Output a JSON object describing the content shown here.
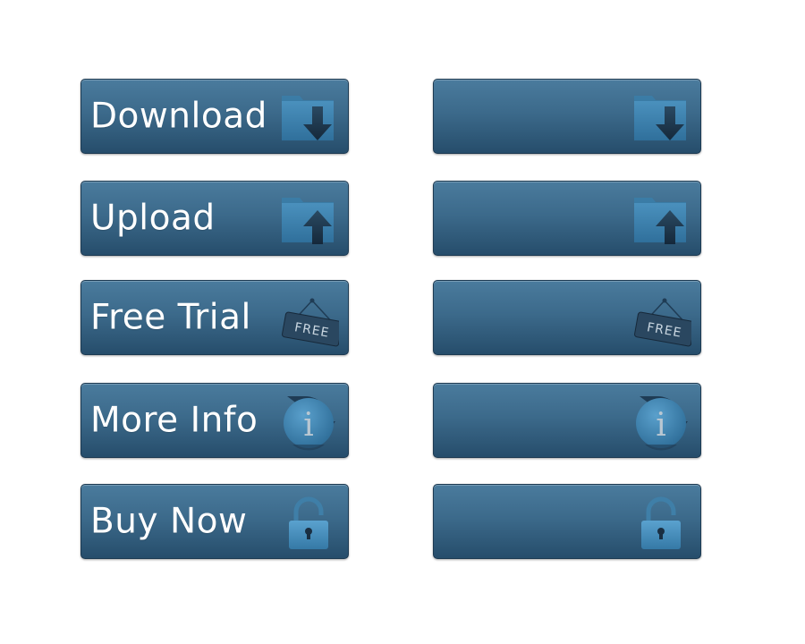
{
  "buttons": [
    {
      "label": "Download",
      "icon": "download-folder-icon"
    },
    {
      "label": "Upload",
      "icon": "upload-folder-icon"
    },
    {
      "label": "Free Trial",
      "icon": "free-sign-icon",
      "icon_text": "FREE"
    },
    {
      "label": "More Info",
      "icon": "info-icon",
      "icon_text": "i"
    },
    {
      "label": "Buy Now",
      "icon": "padlock-icon"
    }
  ],
  "colors": {
    "button_top": "#4a7b9d",
    "button_bottom": "#264d6b",
    "button_border": "#1d3a52",
    "label_text": "#ffffff",
    "icon_light": "#3f85b3",
    "icon_dark": "#1f3c55"
  }
}
